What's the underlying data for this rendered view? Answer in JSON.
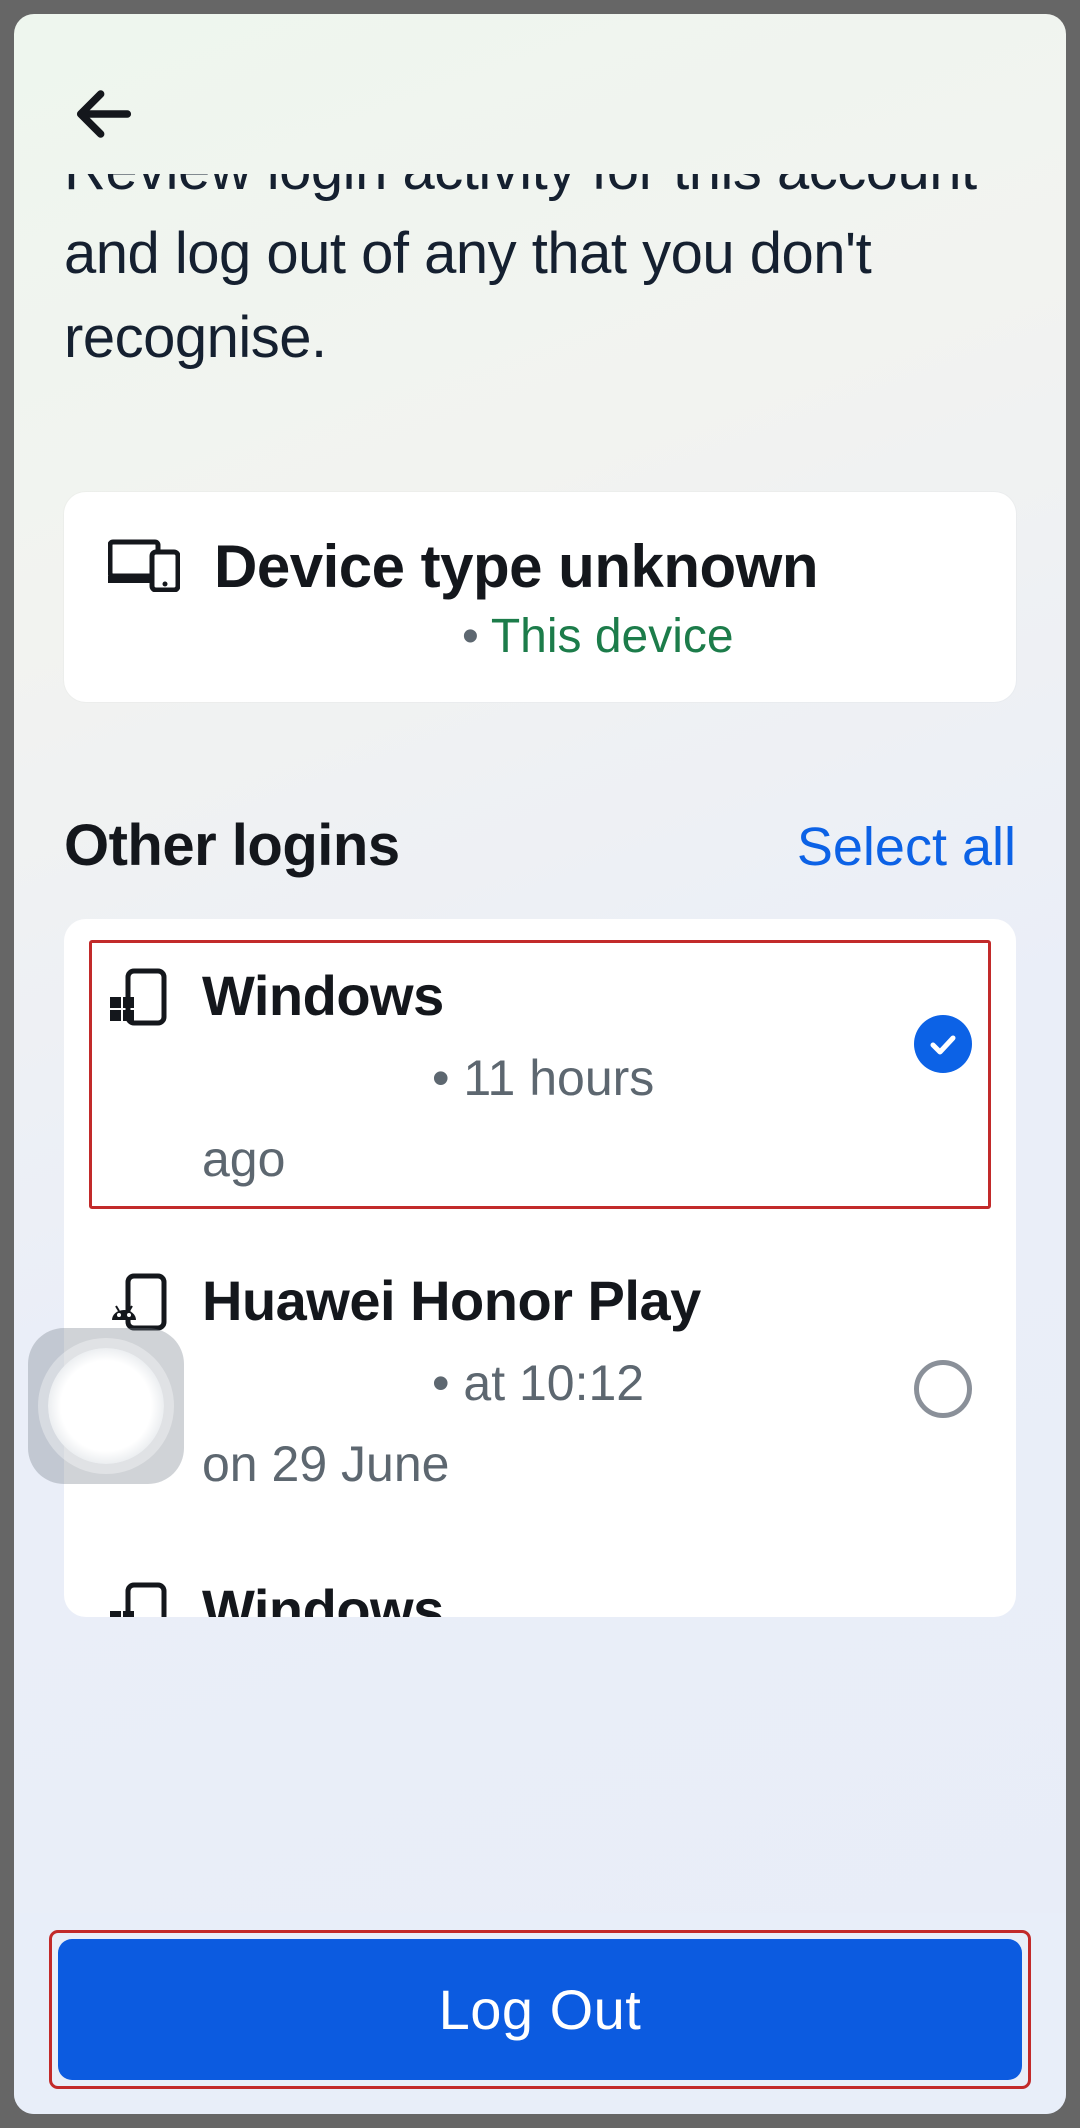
{
  "description": "Review login activity for this account and log out of any that you don't recognise.",
  "current_device": {
    "title": "Device type unknown",
    "badge": "This device"
  },
  "section": {
    "title": "Other logins",
    "select_all": "Select all"
  },
  "logins": [
    {
      "title": "Windows",
      "sub_inline": "11 hours",
      "sub_wrap": "ago",
      "selected": true
    },
    {
      "title": "Huawei Honor Play",
      "sub_inline": "at 10:12",
      "sub_wrap": "on 29 June",
      "selected": false
    },
    {
      "title": "Windows",
      "sub_inline": "",
      "sub_wrap": "",
      "selected": false
    }
  ],
  "logout_label": "Log Out"
}
